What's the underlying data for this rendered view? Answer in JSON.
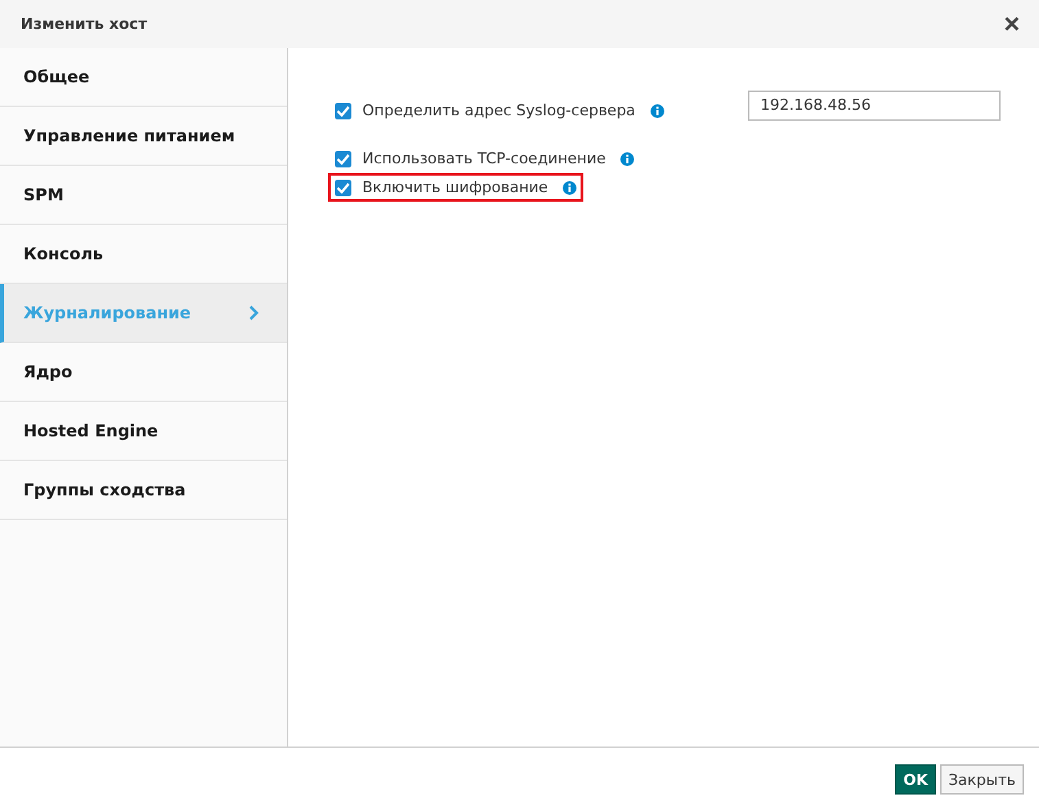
{
  "window": {
    "title": "Изменить хост",
    "close": "×"
  },
  "sidebar": {
    "items": [
      {
        "label": "Общее",
        "selected": false
      },
      {
        "label": "Управление питанием",
        "selected": false
      },
      {
        "label": "SPM",
        "selected": false
      },
      {
        "label": "Консоль",
        "selected": false
      },
      {
        "label": "Журналирование",
        "selected": true
      },
      {
        "label": "Ядро",
        "selected": false
      },
      {
        "label": "Hosted Engine",
        "selected": false
      },
      {
        "label": "Группы сходства",
        "selected": false
      }
    ]
  },
  "options": [
    {
      "label": "Определить адрес Syslog-сервера",
      "checked": true,
      "highlighted": false,
      "value": "192.168.48.56"
    },
    {
      "label": "Использовать TCP-соединение",
      "checked": true,
      "highlighted": false
    },
    {
      "label": "Включить шифрование",
      "checked": true,
      "highlighted": true
    }
  ],
  "buttons": [
    {
      "label": "OK",
      "kind": "primary"
    },
    {
      "label": "Закрыть",
      "kind": "secondary"
    }
  ]
}
